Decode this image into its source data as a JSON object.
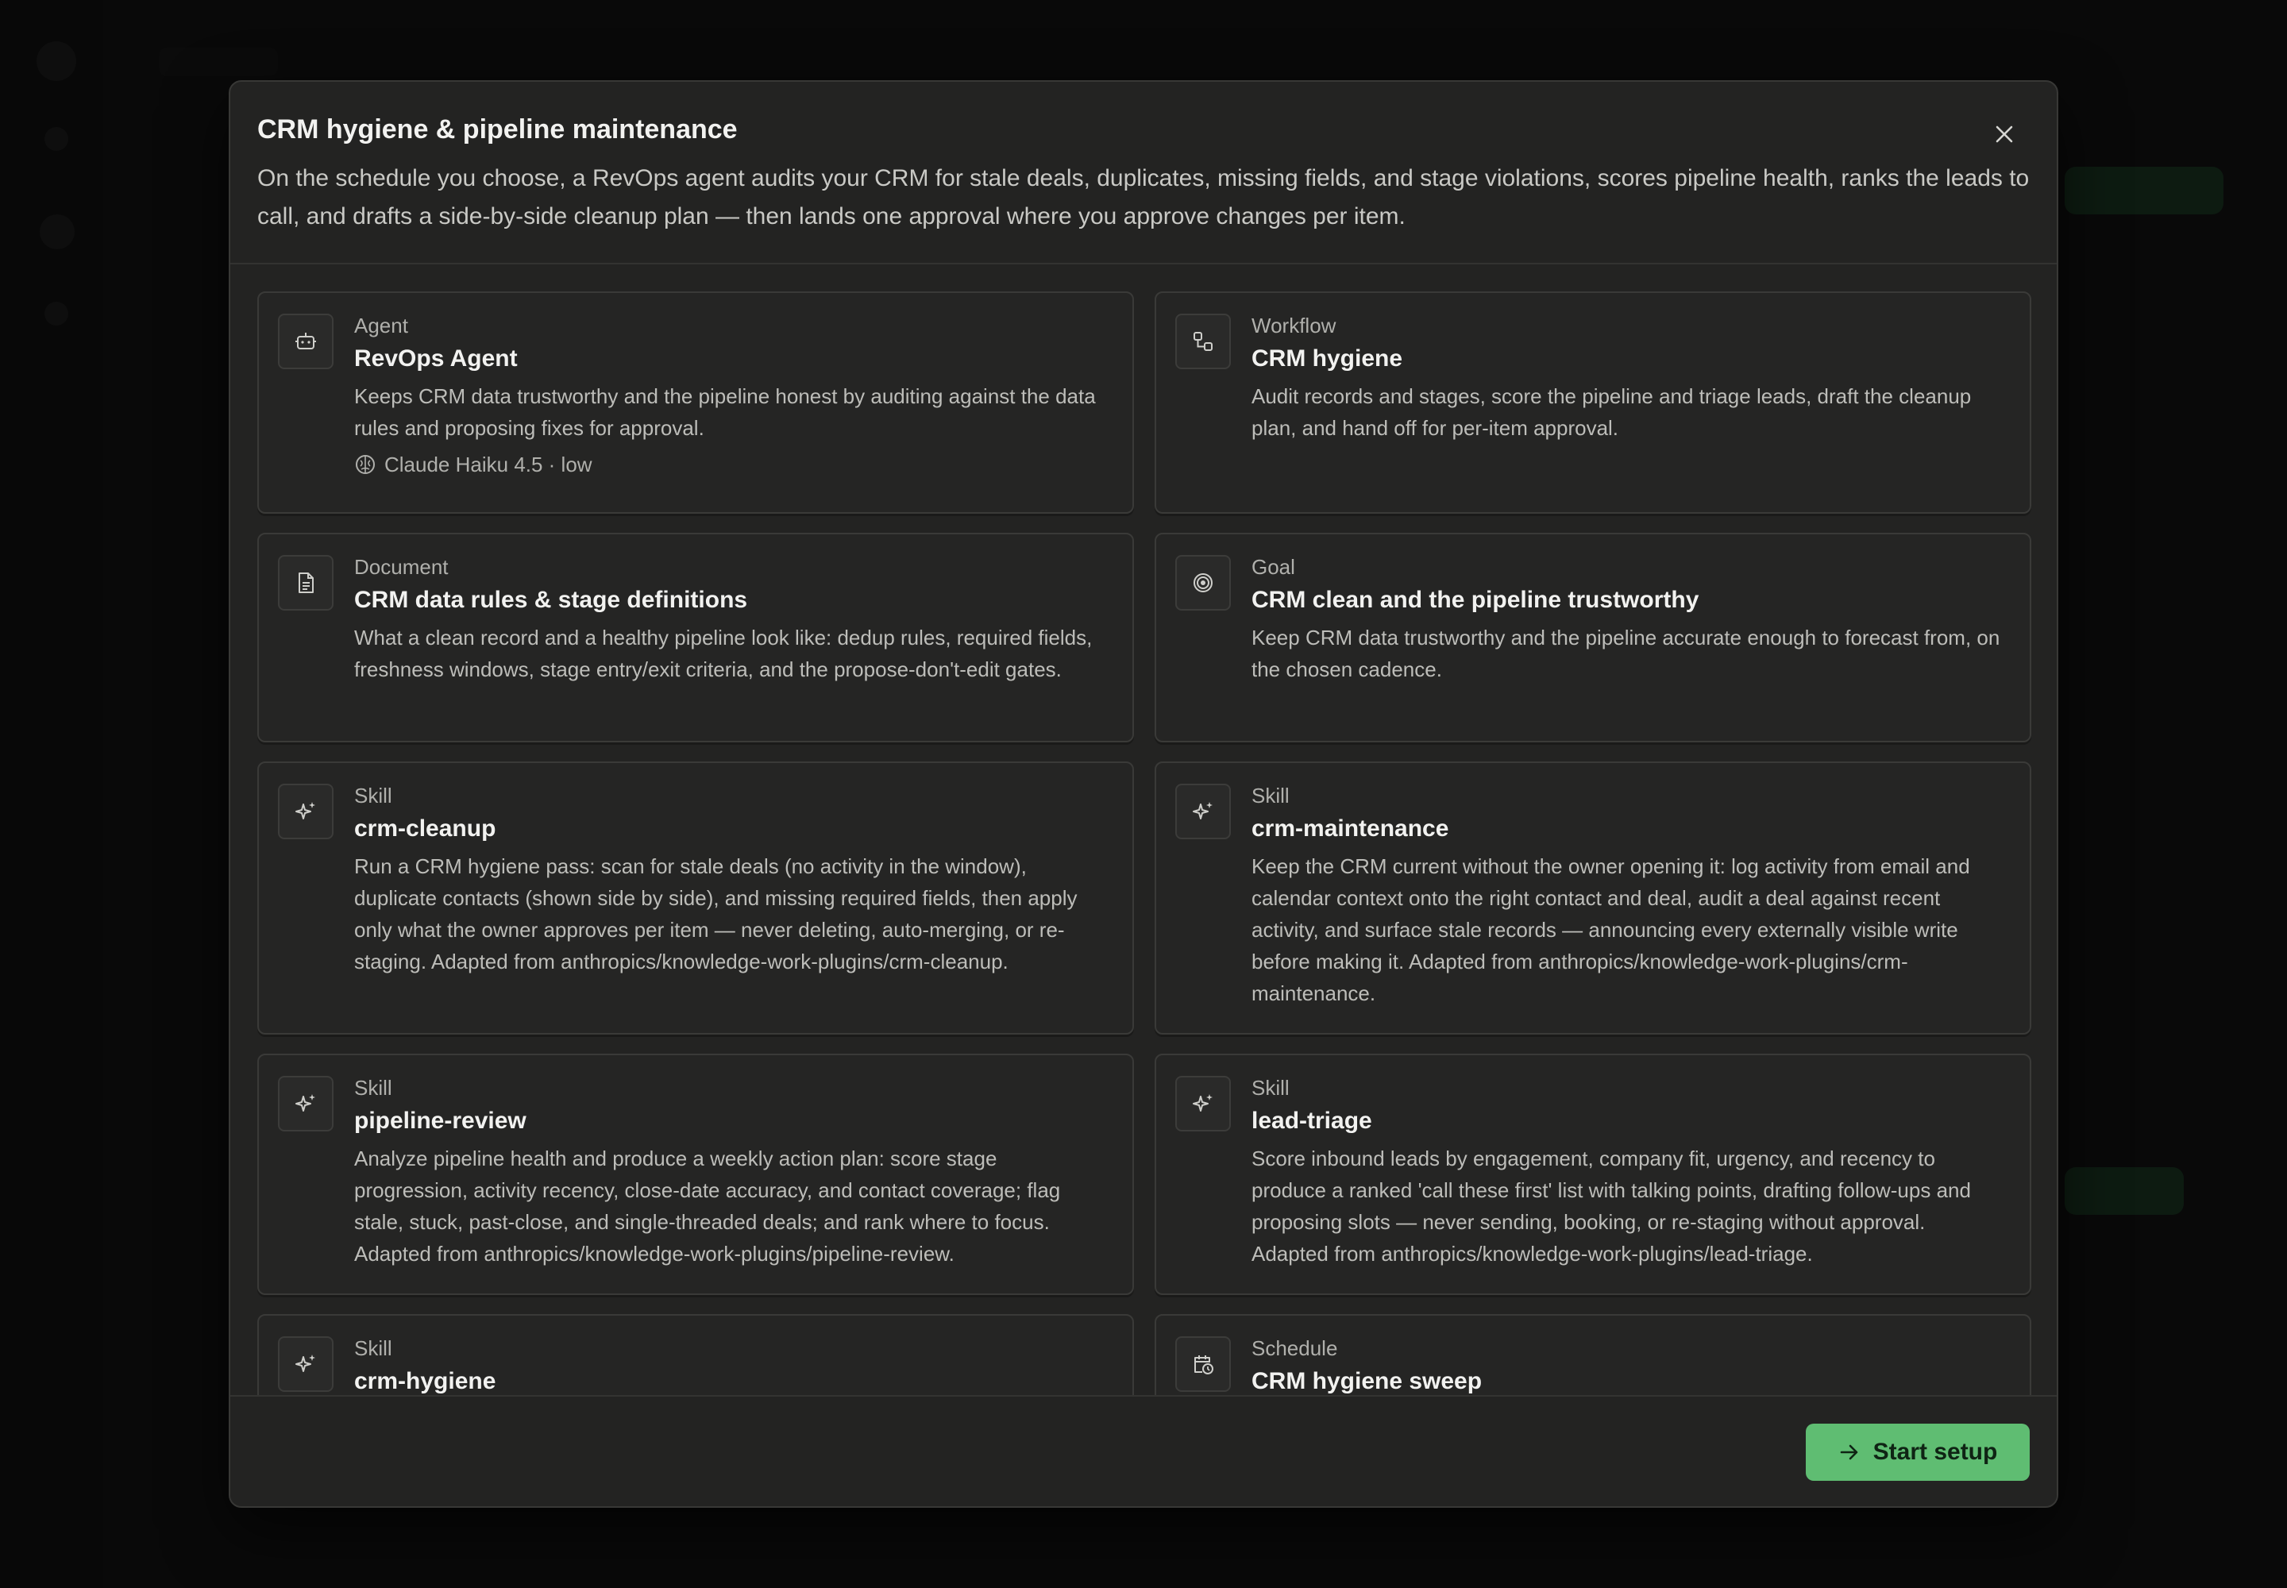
{
  "modal": {
    "title": "CRM hygiene & pipeline maintenance",
    "description": "On the schedule you choose, a RevOps agent audits your CRM for stale deals, duplicates, missing fields, and stage violations, scores pipeline health, ranks the leads to call, and drafts a side-by-side cleanup plan — then lands one approval where you approve changes per item.",
    "close_icon": "close-icon"
  },
  "cards": [
    {
      "kind": "Agent",
      "name": "RevOps Agent",
      "desc": "Keeps CRM data trustworthy and the pipeline honest by auditing against the data rules and proposing fixes for approval.",
      "meta": "Claude Haiku 4.5 · low",
      "icon": "robot-icon"
    },
    {
      "kind": "Workflow",
      "name": "CRM hygiene",
      "desc": "Audit records and stages, score the pipeline and triage leads, draft the cleanup plan, and hand off for per-item approval.",
      "icon": "workflow-icon"
    },
    {
      "kind": "Document",
      "name": "CRM data rules & stage definitions",
      "desc": "What a clean record and a healthy pipeline look like: dedup rules, required fields, freshness windows, stage entry/exit criteria, and the propose-don't-edit gates.",
      "icon": "document-icon"
    },
    {
      "kind": "Goal",
      "name": "CRM clean and the pipeline trustworthy",
      "desc": "Keep CRM data trustworthy and the pipeline accurate enough to forecast from, on the chosen cadence.",
      "icon": "target-icon"
    },
    {
      "kind": "Skill",
      "name": "crm-cleanup",
      "desc": "Run a CRM hygiene pass: scan for stale deals (no activity in the window), duplicate contacts (shown side by side), and missing required fields, then apply only what the owner approves per item — never deleting, auto-merging, or re-staging. Adapted from anthropics/knowledge-work-plugins/crm-cleanup.",
      "icon": "sparkle-icon"
    },
    {
      "kind": "Skill",
      "name": "crm-maintenance",
      "desc": "Keep the CRM current without the owner opening it: log activity from email and calendar context onto the right contact and deal, audit a deal against recent activity, and surface stale records — announcing every externally visible write before making it. Adapted from anthropics/knowledge-work-plugins/crm-maintenance.",
      "icon": "sparkle-icon"
    },
    {
      "kind": "Skill",
      "name": "pipeline-review",
      "desc": "Analyze pipeline health and produce a weekly action plan: score stage progression, activity recency, close-date accuracy, and contact coverage; flag stale, stuck, past-close, and single-threaded deals; and rank where to focus. Adapted from anthropics/knowledge-work-plugins/pipeline-review.",
      "icon": "sparkle-icon"
    },
    {
      "kind": "Skill",
      "name": "lead-triage",
      "desc": "Score inbound leads by engagement, company fit, urgency, and recency to produce a ranked 'call these first' list with talking points, drafting follow-ups and proposing slots — never sending, booking, or re-staging without approval. Adapted from anthropics/knowledge-work-plugins/lead-triage.",
      "icon": "sparkle-icon"
    },
    {
      "kind": "Skill",
      "name": "crm-hygiene",
      "desc": "",
      "icon": "sparkle-icon"
    },
    {
      "kind": "Schedule",
      "name": "CRM hygiene sweep",
      "desc": "",
      "icon": "calendar-clock-icon"
    }
  ],
  "footer": {
    "start_label": "Start setup",
    "start_icon": "arrow-right-icon",
    "accent": "#5fbd72"
  }
}
